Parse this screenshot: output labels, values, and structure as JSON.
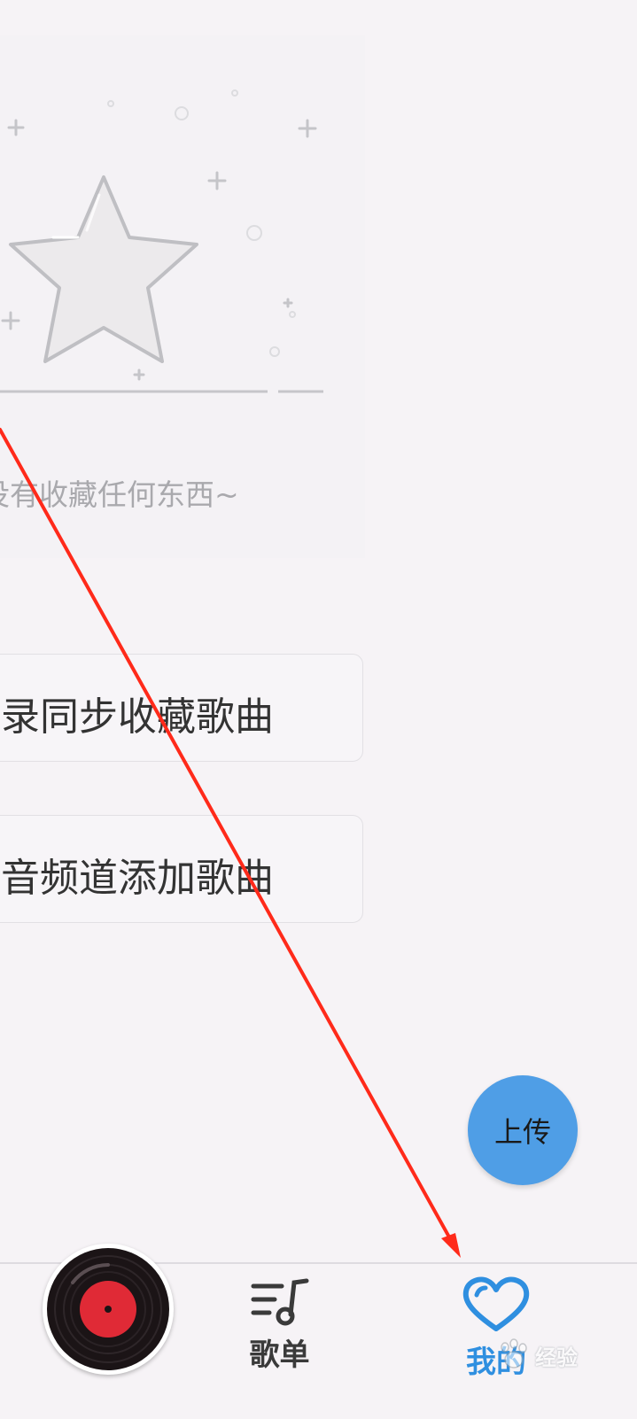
{
  "empty_state": {
    "message": "没有收藏任何东西~",
    "icon": "star-icon"
  },
  "actions": {
    "sync_favorites_label": "录同步收藏歌曲",
    "add_from_channel_label": "音频道添加歌曲"
  },
  "fab": {
    "upload_label": "上传"
  },
  "tabbar": {
    "playlist_label": "歌单",
    "mine_label": "我的",
    "active_tab": "我的"
  },
  "watermark": {
    "text": "经验"
  },
  "colors": {
    "accent": "#2f8fe0",
    "fab": "#4f9ee6",
    "annotation_arrow": "#ff2a1a",
    "disc_label": "#e02a36"
  }
}
